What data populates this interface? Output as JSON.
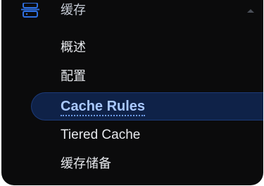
{
  "section": {
    "label": "缓存",
    "icon": "server-stack-icon",
    "expanded": true,
    "chevron_icon": "chevron-up-icon"
  },
  "menu": {
    "items": [
      {
        "label": "概述",
        "active": false
      },
      {
        "label": "配置",
        "active": false
      },
      {
        "label": "Cache Rules",
        "active": true
      },
      {
        "label": "Tiered Cache",
        "active": false
      },
      {
        "label": "缓存储备",
        "active": false
      }
    ]
  },
  "colors": {
    "background": "#0b0b0c",
    "text": "#e6e8ec",
    "accent_text": "#a9c8ff",
    "active_background": "#0f2248",
    "icon": "#2f6fe0"
  }
}
